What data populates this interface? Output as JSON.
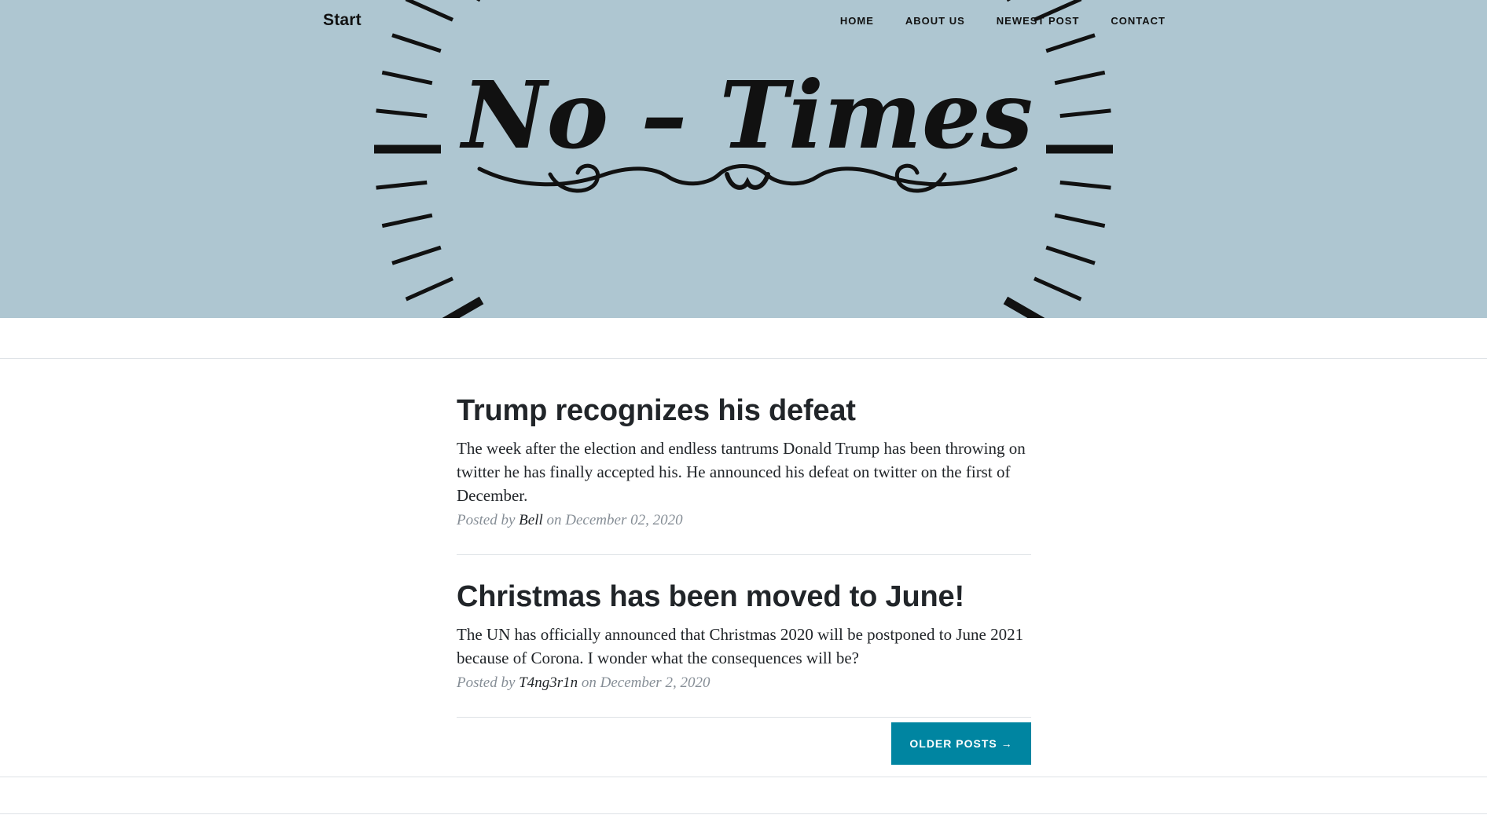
{
  "navbar": {
    "brand": "Start",
    "items": [
      {
        "label": "Home"
      },
      {
        "label": "About us"
      },
      {
        "label": "Newest Post"
      },
      {
        "label": "Contact"
      }
    ]
  },
  "header": {
    "logo_text": "No – Times",
    "background_color": "#aec6d1"
  },
  "posts": [
    {
      "title": "Trump recognizes his defeat",
      "subtitle": "The week after the election and endless tantrums Donald Trump has been throwing on twitter he has finally accepted his. He announced his defeat on twitter on the first of December.",
      "meta_prefix": "Posted by",
      "author": "Bell",
      "meta_on": "on",
      "date": "December 02, 2020"
    },
    {
      "title": "Christmas has been moved to June!",
      "subtitle": "The UN has officially announced that Christmas 2020 will be postponed to June 2021 because of Corona. I wonder what the consequences will be?",
      "meta_prefix": "Posted by",
      "author": "T4ng3r1n",
      "meta_on": "on",
      "date": "December 2, 2020"
    }
  ],
  "pager": {
    "older_label": "Older Posts →"
  },
  "colors": {
    "accent": "#0085a1",
    "text": "#212529",
    "muted": "#868e96"
  }
}
